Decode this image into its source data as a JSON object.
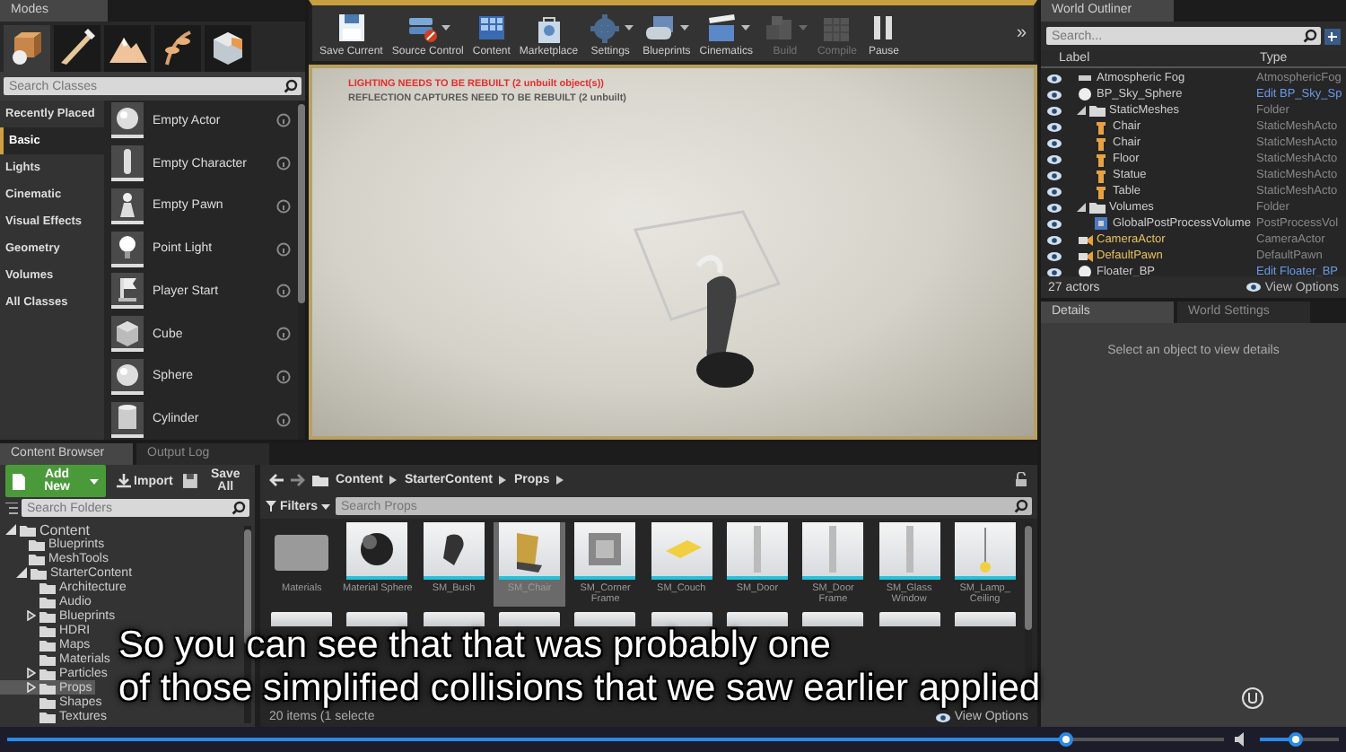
{
  "modes_panel": {
    "tab": "Modes",
    "mode_buttons": [
      {
        "kind": "place",
        "selected": true
      },
      {
        "kind": "paint",
        "selected": false
      },
      {
        "kind": "landscape",
        "selected": false
      },
      {
        "kind": "foliage",
        "selected": false
      },
      {
        "kind": "geometry",
        "selected": false
      }
    ],
    "search": {
      "placeholder": "Search Classes"
    },
    "categories": [
      {
        "label": "Recently Placed",
        "selected": false
      },
      {
        "label": "Basic",
        "selected": true
      },
      {
        "label": "Lights",
        "selected": false
      },
      {
        "label": "Cinematic",
        "selected": false
      },
      {
        "label": "Visual Effects",
        "selected": false
      },
      {
        "label": "Geometry",
        "selected": false
      },
      {
        "label": "Volumes",
        "selected": false
      },
      {
        "label": "All Classes",
        "selected": false
      }
    ],
    "items": [
      {
        "label": "Empty Actor",
        "kind": "sphere"
      },
      {
        "label": "Empty Character",
        "kind": "capsule"
      },
      {
        "label": "Empty Pawn",
        "kind": "pawn"
      },
      {
        "label": "Point Light",
        "kind": "bulb"
      },
      {
        "label": "Player Start",
        "kind": "flag"
      },
      {
        "label": "Cube",
        "kind": "cube"
      },
      {
        "label": "Sphere",
        "kind": "sphere"
      },
      {
        "label": "Cylinder",
        "kind": "cylinder"
      }
    ]
  },
  "toolbar": {
    "buttons": [
      {
        "label": "Save Current",
        "kind": "save",
        "dropdown": false,
        "disabled": false
      },
      {
        "label": "Source Control",
        "kind": "source",
        "dropdown": true,
        "disabled": false
      },
      {
        "label": "Content",
        "kind": "content",
        "dropdown": false,
        "disabled": false
      },
      {
        "label": "Marketplace",
        "kind": "marketplace",
        "dropdown": false,
        "disabled": false
      },
      {
        "label": "Settings",
        "kind": "settings",
        "dropdown": true,
        "disabled": false
      },
      {
        "label": "Blueprints",
        "kind": "blueprints",
        "dropdown": true,
        "disabled": false
      },
      {
        "label": "Cinematics",
        "kind": "cinematics",
        "dropdown": true,
        "disabled": false
      },
      {
        "label": "Build",
        "kind": "build",
        "dropdown": true,
        "disabled": true
      },
      {
        "label": "Compile",
        "kind": "compile",
        "dropdown": false,
        "disabled": true
      },
      {
        "label": "Pause",
        "kind": "pause",
        "dropdown": false,
        "disabled": false
      }
    ],
    "overflow": "»"
  },
  "viewport": {
    "messages": [
      {
        "text": "LIGHTING NEEDS TO BE REBUILT (2 unbuilt object(s))",
        "kind": "error"
      },
      {
        "text": "REFLECTION CAPTURES NEED TO BE REBUILT (2 unbuilt)",
        "kind": "warning"
      }
    ]
  },
  "world_outliner": {
    "tab": "World Outliner",
    "search": {
      "placeholder": "Search..."
    },
    "columns": [
      "Label",
      "Type"
    ],
    "rows": [
      {
        "label": "Atmospheric Fog",
        "type": "AtmosphericFog",
        "kind": "actor",
        "type_link": false
      },
      {
        "label": "BP_Sky_Sphere",
        "type": "Edit BP_Sky_Sp",
        "kind": "blueprint",
        "type_link": true
      },
      {
        "label": "StaticMeshes",
        "type": "Folder",
        "kind": "folder",
        "type_link": false,
        "expanded": true,
        "children": [
          {
            "label": "Chair",
            "type": "StaticMeshActo",
            "kind": "mesh",
            "type_link": false
          },
          {
            "label": "Chair",
            "type": "StaticMeshActo",
            "kind": "mesh",
            "type_link": false
          },
          {
            "label": "Floor",
            "type": "StaticMeshActo",
            "kind": "mesh",
            "type_link": false
          },
          {
            "label": "Statue",
            "type": "StaticMeshActo",
            "kind": "mesh",
            "type_link": false
          },
          {
            "label": "Table",
            "type": "StaticMeshActo",
            "kind": "mesh",
            "type_link": false
          }
        ]
      },
      {
        "label": "Volumes",
        "type": "Folder",
        "kind": "folder",
        "type_link": false,
        "expanded": true,
        "children": [
          {
            "label": "GlobalPostProcessVolume",
            "type": "PostProcessVol",
            "kind": "volume",
            "type_link": false
          }
        ]
      },
      {
        "label": "CameraActor",
        "type": "CameraActor",
        "kind": "spawned",
        "type_link": false
      },
      {
        "label": "DefaultPawn",
        "type": "DefaultPawn",
        "kind": "spawned",
        "type_link": false
      },
      {
        "label": "Floater_BP",
        "type": "Edit Floater_BP",
        "kind": "blueprint",
        "type_link": true
      }
    ],
    "count": "27 actors",
    "view_options": "View Options"
  },
  "details_panel": {
    "tabs": [
      {
        "label": "Details",
        "selected": true
      },
      {
        "label": "World Settings",
        "selected": false
      }
    ],
    "message": "Select an object to view details"
  },
  "content_browser": {
    "tabs": [
      {
        "label": "Content Browser",
        "selected": true
      },
      {
        "label": "Output Log",
        "selected": false
      }
    ],
    "add_new": "Add New",
    "import": "Import",
    "save_all": "Save All",
    "folder_search": {
      "placeholder": "Search Folders"
    },
    "folders": [
      {
        "label": "Content",
        "kind": "branch",
        "expanded": true,
        "selected": false,
        "children": [
          {
            "label": "Blueprints",
            "kind": "leaf",
            "selected": false
          },
          {
            "label": "MeshTools",
            "kind": "leaf",
            "selected": false
          },
          {
            "label": "StarterContent",
            "kind": "branch",
            "expanded": true,
            "selected": false,
            "children": [
              {
                "label": "Architecture",
                "kind": "leaf",
                "selected": false
              },
              {
                "label": "Audio",
                "kind": "leaf",
                "selected": false
              },
              {
                "label": "Blueprints",
                "kind": "branch",
                "expanded": false,
                "selected": false
              },
              {
                "label": "HDRI",
                "kind": "leaf",
                "selected": false
              },
              {
                "label": "Maps",
                "kind": "leaf",
                "selected": false
              },
              {
                "label": "Materials",
                "kind": "leaf",
                "selected": false
              },
              {
                "label": "Particles",
                "kind": "branch",
                "expanded": false,
                "selected": false
              },
              {
                "label": "Props",
                "kind": "branch",
                "expanded": false,
                "selected": true
              },
              {
                "label": "Shapes",
                "kind": "leaf",
                "selected": false
              },
              {
                "label": "Textures",
                "kind": "leaf",
                "selected": false
              }
            ]
          }
        ]
      }
    ],
    "path": [
      "Content",
      "StarterContent",
      "Props"
    ],
    "filters": "Filters",
    "asset_search": {
      "placeholder": "Search Props"
    },
    "assets": [
      {
        "label": "Materials",
        "kind": "folder",
        "selected": false
      },
      {
        "label": "Material Sphere",
        "kind": "sphere",
        "selected": false
      },
      {
        "label": "SM_Bush",
        "kind": "bush",
        "selected": false
      },
      {
        "label": "SM_Chair",
        "kind": "chair",
        "selected": true
      },
      {
        "label": "SM_Corner Frame",
        "kind": "frame",
        "selected": false
      },
      {
        "label": "SM_Couch",
        "kind": "couch",
        "selected": false
      },
      {
        "label": "SM_Door",
        "kind": "door",
        "selected": false
      },
      {
        "label": "SM_Door Frame",
        "kind": "door",
        "selected": false
      },
      {
        "label": "SM_Glass Window",
        "kind": "door",
        "selected": false
      },
      {
        "label": "SM_Lamp_ Ceiling",
        "kind": "lamp",
        "selected": false
      }
    ],
    "more_assets": [
      {
        "kind": "mesh"
      },
      {
        "kind": "mesh"
      },
      {
        "kind": "mesh"
      },
      {
        "kind": "mesh"
      },
      {
        "kind": "mesh"
      },
      {
        "kind": "mesh"
      },
      {
        "kind": "mesh"
      },
      {
        "kind": "mesh"
      },
      {
        "kind": "mesh"
      },
      {
        "kind": "mesh"
      }
    ],
    "status": "20 items (1 selecte",
    "view_options": "View Options"
  },
  "subtitles": [
    "So you can see that that was probably one",
    "of those simplified collisions that we saw earlier applied"
  ],
  "player": {
    "progress": {
      "level": 0.87
    },
    "volume": {
      "level": 0.45
    }
  }
}
